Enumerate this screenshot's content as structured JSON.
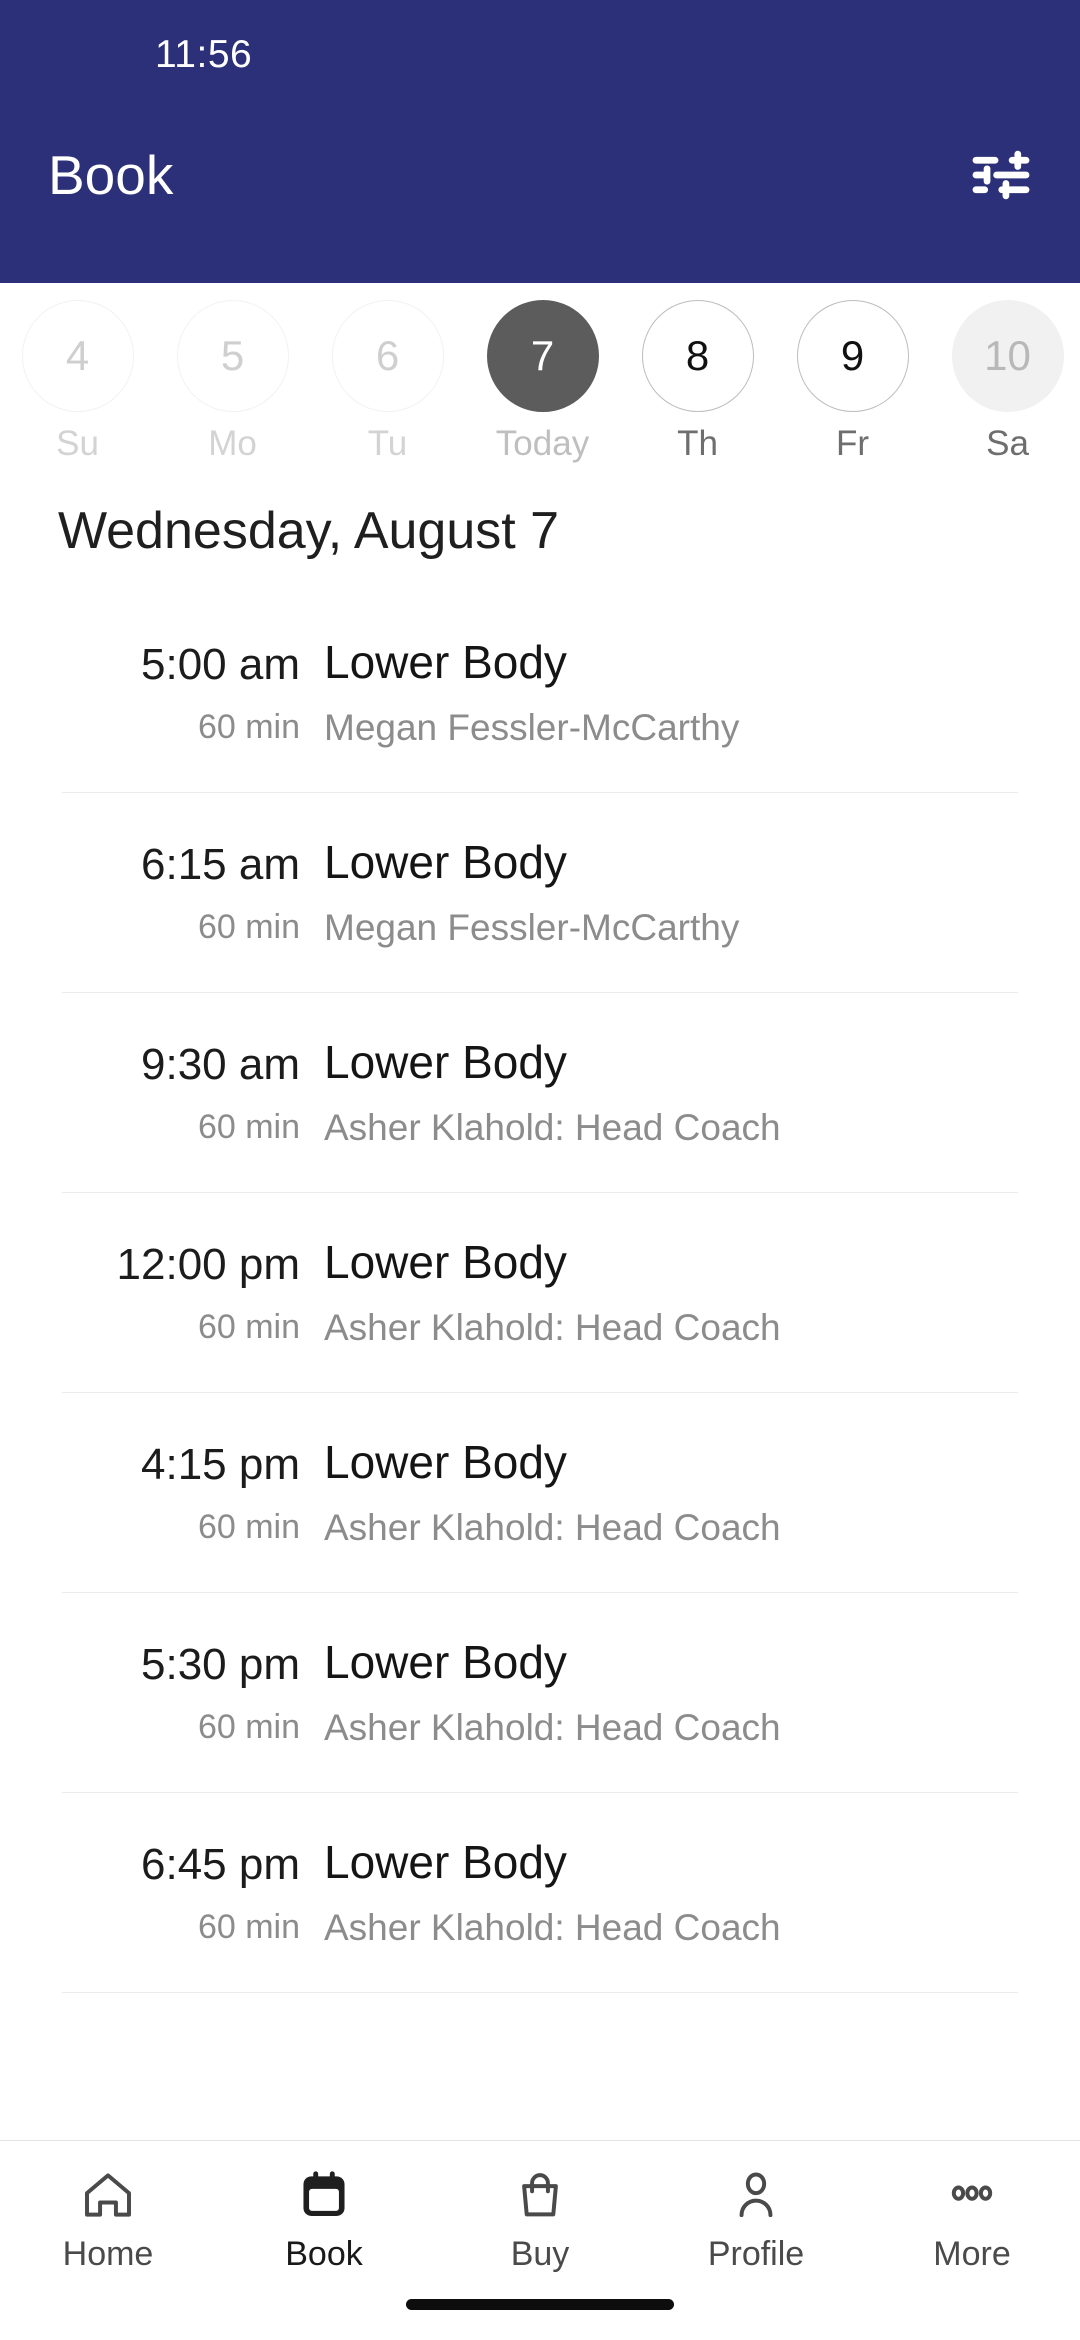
{
  "status_bar": {
    "time": "11:56"
  },
  "header": {
    "title": "Book",
    "filter_icon": "tune-icon",
    "background_color": "#2c3078"
  },
  "date_strip": {
    "days": [
      {
        "number": "4",
        "label": "Su",
        "state": "past"
      },
      {
        "number": "5",
        "label": "Mo",
        "state": "past"
      },
      {
        "number": "6",
        "label": "Tu",
        "state": "past"
      },
      {
        "number": "7",
        "label": "Today",
        "state": "selected"
      },
      {
        "number": "8",
        "label": "Th",
        "state": "active"
      },
      {
        "number": "9",
        "label": "Fr",
        "state": "active"
      },
      {
        "number": "10",
        "label": "Sa",
        "state": "edge"
      }
    ],
    "selected_color": "#5c5c5c"
  },
  "date_heading": "Wednesday, August 7",
  "classes": [
    {
      "time": "5:00 am",
      "duration": "60 min",
      "name": "Lower Body",
      "coach": "Megan Fessler-McCarthy"
    },
    {
      "time": "6:15 am",
      "duration": "60 min",
      "name": "Lower Body",
      "coach": "Megan Fessler-McCarthy"
    },
    {
      "time": "9:30 am",
      "duration": "60 min",
      "name": "Lower Body",
      "coach": "Asher Klahold: Head Coach"
    },
    {
      "time": "12:00 pm",
      "duration": "60 min",
      "name": "Lower Body",
      "coach": "Asher Klahold: Head Coach"
    },
    {
      "time": "4:15 pm",
      "duration": "60 min",
      "name": "Lower Body",
      "coach": "Asher Klahold: Head Coach"
    },
    {
      "time": "5:30 pm",
      "duration": "60 min",
      "name": "Lower Body",
      "coach": "Asher Klahold: Head Coach"
    },
    {
      "time": "6:45 pm",
      "duration": "60 min",
      "name": "Lower Body",
      "coach": "Asher Klahold: Head Coach"
    }
  ],
  "tab_bar": {
    "tabs": [
      {
        "label": "Home",
        "icon": "home-icon",
        "active": false
      },
      {
        "label": "Book",
        "icon": "calendar-icon",
        "active": true
      },
      {
        "label": "Buy",
        "icon": "bag-icon",
        "active": false
      },
      {
        "label": "Profile",
        "icon": "person-icon",
        "active": false
      },
      {
        "label": "More",
        "icon": "ellipsis-icon",
        "active": false
      }
    ]
  }
}
